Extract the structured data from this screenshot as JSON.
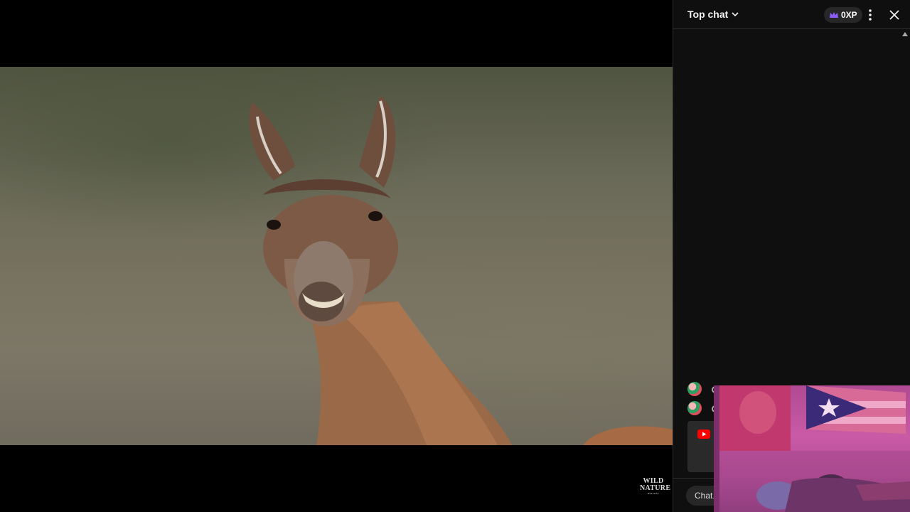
{
  "video": {
    "watermark_line1": "WILD",
    "watermark_line2": "NATURE",
    "watermark_line3": "HOLIDAY"
  },
  "chat": {
    "mode_label": "Top chat",
    "xp_label": "0XP",
    "input_placeholder": "Chat...",
    "input_visible_text": "Chat."
  },
  "icons": {
    "chevron": "chevron-down-icon",
    "crown": "crown-icon",
    "more": "more-vert-icon",
    "close": "close-icon",
    "youtube": "youtube-icon"
  },
  "colors": {
    "panel_bg": "#0f0f0f",
    "crown_purple": "#8d5cf6",
    "youtube_red": "#ff0000"
  }
}
